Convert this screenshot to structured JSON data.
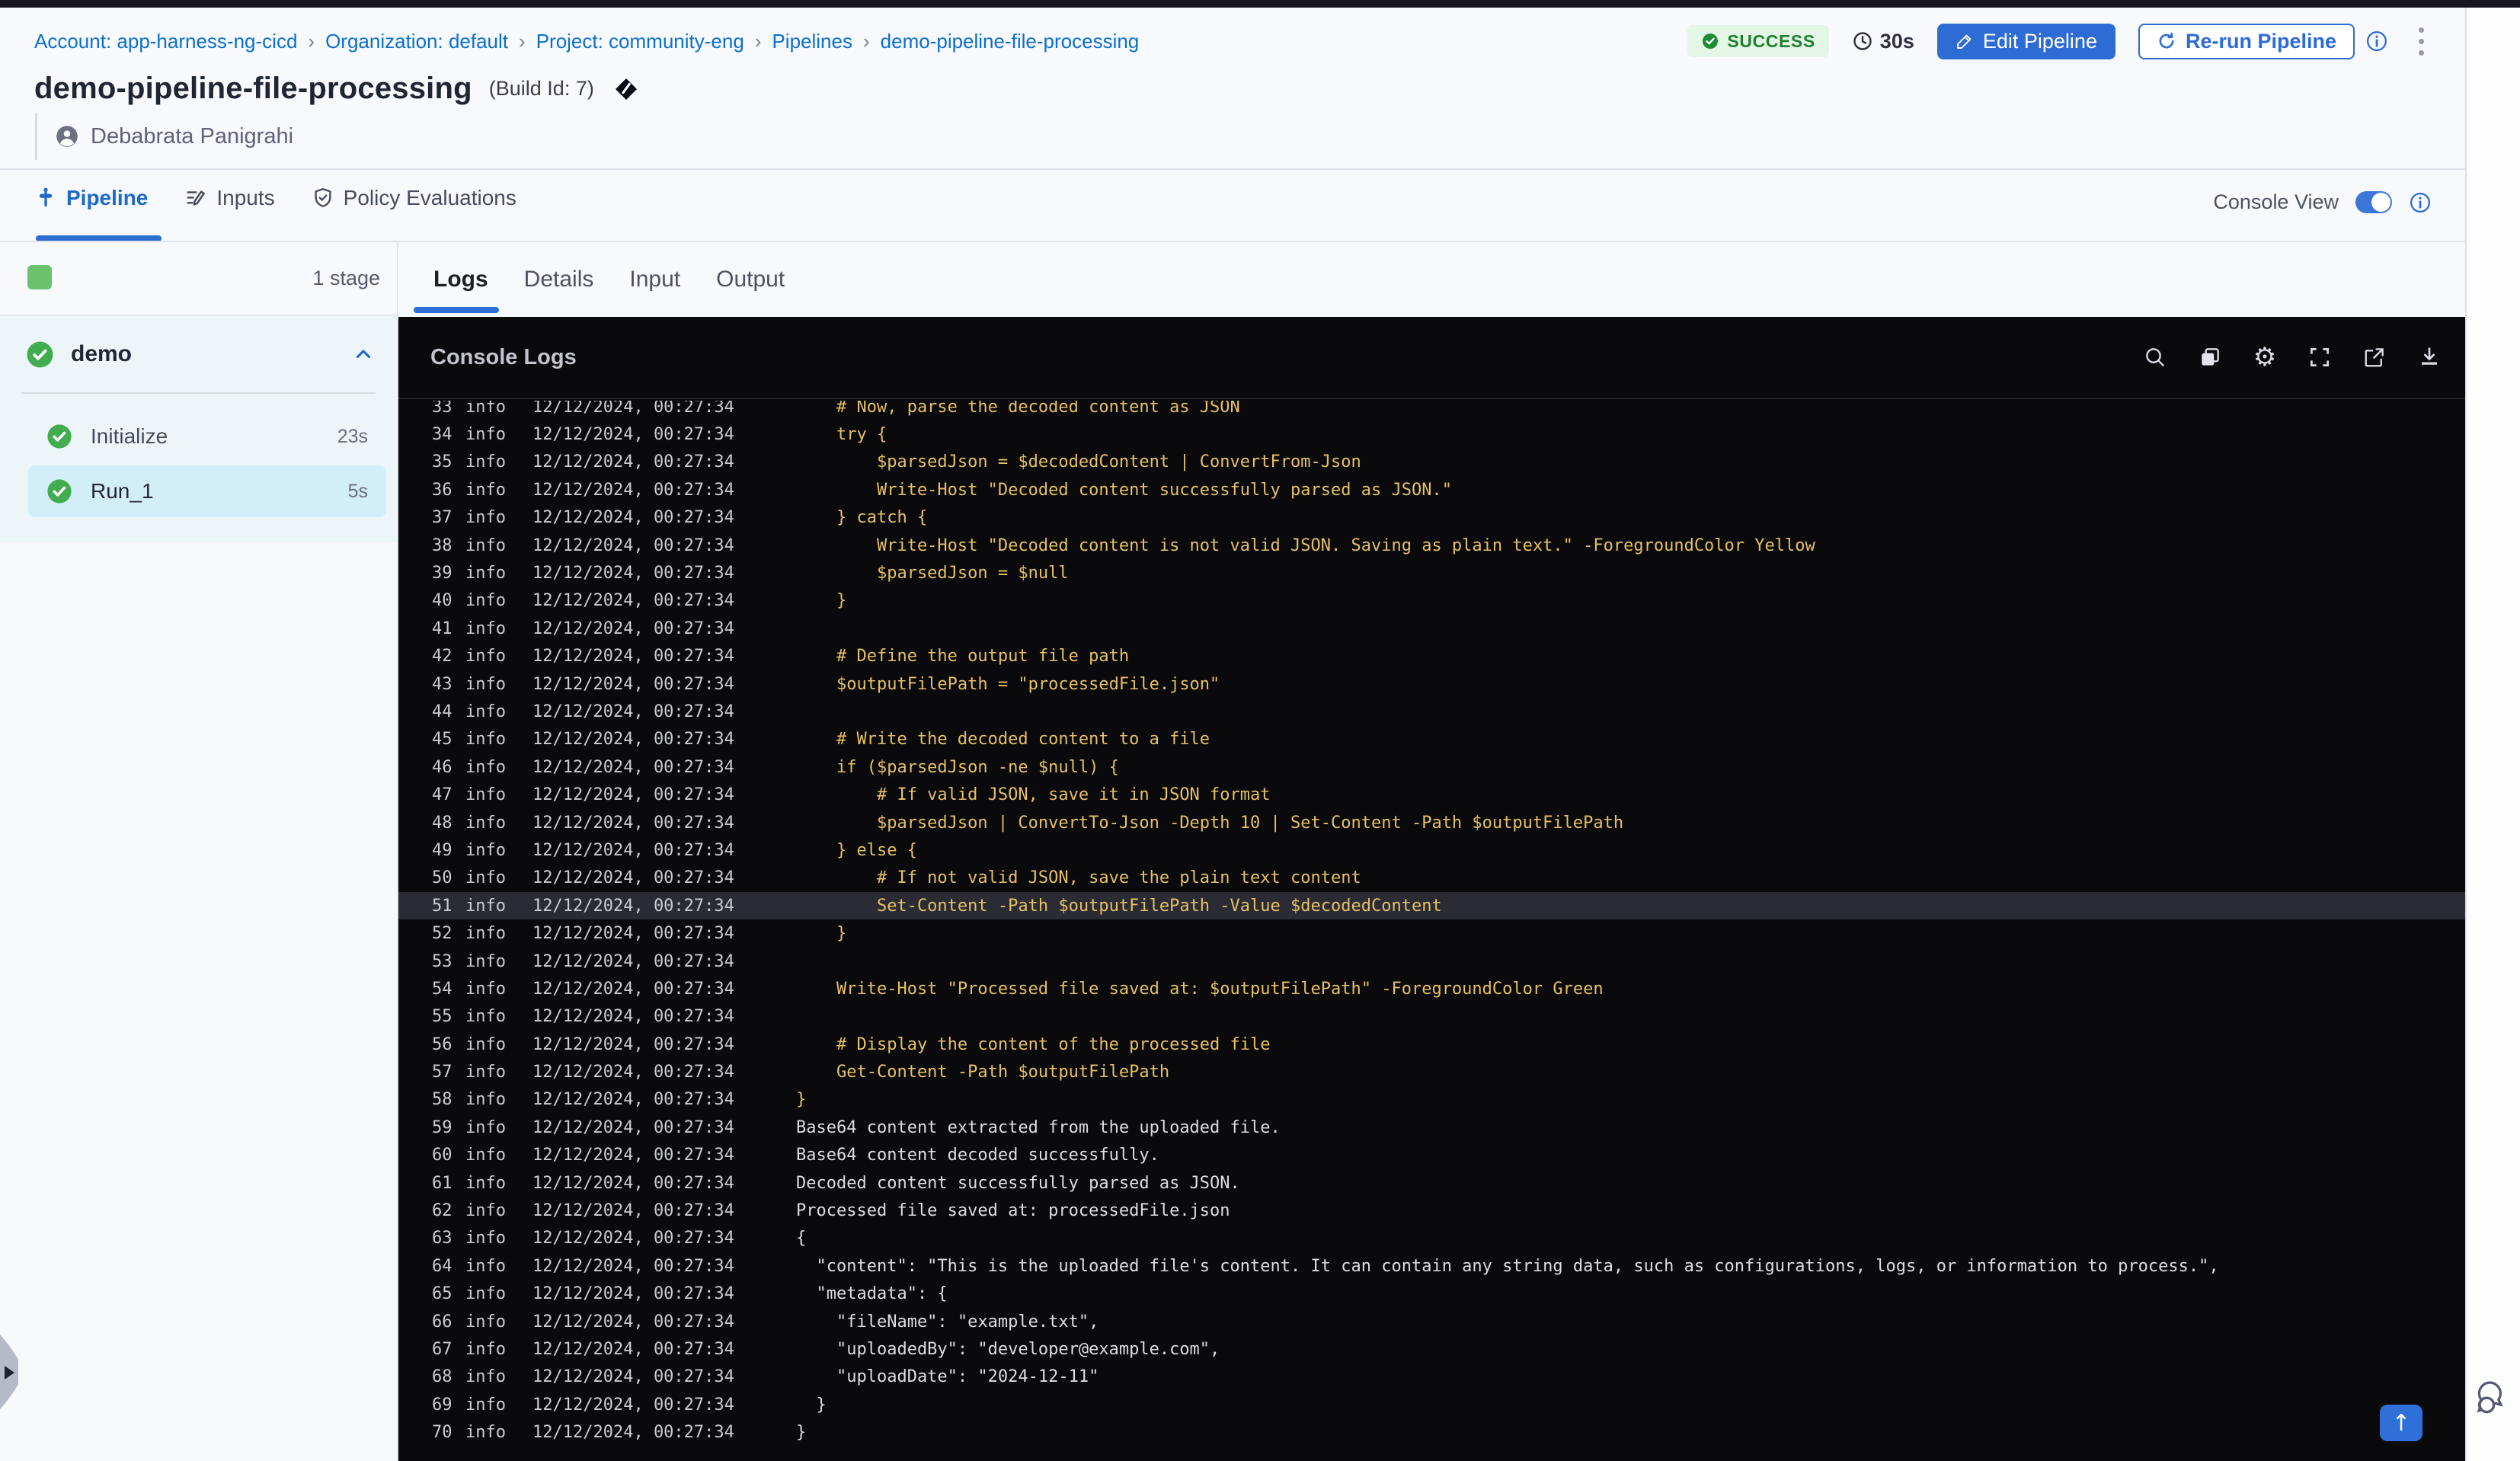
{
  "colors": {
    "accent_blue": "#2d6bd5",
    "link_blue": "#0b6fd0",
    "success_bg": "#e4f6e5",
    "success_text": "#1d8030",
    "stage_green": "#6cc16c",
    "check_green": "#42ad4e",
    "console_bg": "#0a0a0c",
    "console_script_yellow": "#e5c065",
    "console_plain_text": "#dcdde0",
    "selected_step_bg": "#d2eef9",
    "highlight_row_bg": "#2b2b33"
  },
  "topbar": {
    "breadcrumb": [
      "Account: app-harness-ng-cicd",
      "Organization: default",
      "Project: community-eng",
      "Pipelines",
      "demo-pipeline-file-processing"
    ],
    "separator": "›",
    "status": "SUCCESS",
    "duration": "30s",
    "edit_label": "Edit Pipeline",
    "rerun_label": "Re-run Pipeline"
  },
  "header": {
    "title": "demo-pipeline-file-processing",
    "build_id": "(Build Id: 7)",
    "author": "Debabrata Panigrahi"
  },
  "pipeline_tabs": [
    {
      "label": "Pipeline",
      "active": true
    },
    {
      "label": "Inputs",
      "active": false
    },
    {
      "label": "Policy Evaluations",
      "active": false
    }
  ],
  "console_view": {
    "label": "Console View",
    "enabled": true
  },
  "sidebar": {
    "stage_count": "1 stage",
    "stage_name": "demo",
    "steps": [
      {
        "name": "Initialize",
        "duration": "23s",
        "selected": false
      },
      {
        "name": "Run_1",
        "duration": "5s",
        "selected": true
      }
    ]
  },
  "panel": {
    "tabs": [
      {
        "label": "Logs",
        "active": true
      },
      {
        "label": "Details",
        "active": false
      },
      {
        "label": "Input",
        "active": false
      },
      {
        "label": "Output",
        "active": false
      }
    ],
    "console_title": "Console Logs",
    "toolbar_icons": [
      "search-icon",
      "copy-icon",
      "settings-icon",
      "fullscreen-icon",
      "open-in-new-icon",
      "download-icon"
    ],
    "scroll_top_arrow": "↑"
  },
  "console": {
    "level": "info",
    "timestamp": "12/12/2024, 00:27:34",
    "rows": [
      {
        "n": 33,
        "kind": "script",
        "text": "    # Now, parse the decoded content as JSON"
      },
      {
        "n": 34,
        "kind": "script",
        "text": "    try {"
      },
      {
        "n": 35,
        "kind": "script",
        "text": "        $parsedJson = $decodedContent | ConvertFrom-Json"
      },
      {
        "n": 36,
        "kind": "script",
        "text": "        Write-Host \"Decoded content successfully parsed as JSON.\""
      },
      {
        "n": 37,
        "kind": "script",
        "text": "    } catch {"
      },
      {
        "n": 38,
        "kind": "script",
        "text": "        Write-Host \"Decoded content is not valid JSON. Saving as plain text.\" -ForegroundColor Yellow"
      },
      {
        "n": 39,
        "kind": "script",
        "text": "        $parsedJson = $null"
      },
      {
        "n": 40,
        "kind": "script",
        "text": "    }"
      },
      {
        "n": 41,
        "kind": "script",
        "text": ""
      },
      {
        "n": 42,
        "kind": "script",
        "text": "    # Define the output file path"
      },
      {
        "n": 43,
        "kind": "script",
        "text": "    $outputFilePath = \"processedFile.json\""
      },
      {
        "n": 44,
        "kind": "script",
        "text": ""
      },
      {
        "n": 45,
        "kind": "script",
        "text": "    # Write the decoded content to a file"
      },
      {
        "n": 46,
        "kind": "script",
        "text": "    if ($parsedJson -ne $null) {"
      },
      {
        "n": 47,
        "kind": "script",
        "text": "        # If valid JSON, save it in JSON format"
      },
      {
        "n": 48,
        "kind": "script",
        "text": "        $parsedJson | ConvertTo-Json -Depth 10 | Set-Content -Path $outputFilePath"
      },
      {
        "n": 49,
        "kind": "script",
        "text": "    } else {"
      },
      {
        "n": 50,
        "kind": "script",
        "text": "        # If not valid JSON, save the plain text content"
      },
      {
        "n": 51,
        "kind": "script",
        "text": "        Set-Content -Path $outputFilePath -Value $decodedContent",
        "hl": true
      },
      {
        "n": 52,
        "kind": "script",
        "text": "    }"
      },
      {
        "n": 53,
        "kind": "script",
        "text": ""
      },
      {
        "n": 54,
        "kind": "script",
        "text": "    Write-Host \"Processed file saved at: $outputFilePath\" -ForegroundColor Green"
      },
      {
        "n": 55,
        "kind": "script",
        "text": ""
      },
      {
        "n": 56,
        "kind": "script",
        "text": "    # Display the content of the processed file"
      },
      {
        "n": 57,
        "kind": "script",
        "text": "    Get-Content -Path $outputFilePath"
      },
      {
        "n": 58,
        "kind": "script",
        "text": "}"
      },
      {
        "n": 59,
        "kind": "plain",
        "text": "Base64 content extracted from the uploaded file."
      },
      {
        "n": 60,
        "kind": "plain",
        "text": "Base64 content decoded successfully."
      },
      {
        "n": 61,
        "kind": "plain",
        "text": "Decoded content successfully parsed as JSON."
      },
      {
        "n": 62,
        "kind": "plain",
        "text": "Processed file saved at: processedFile.json"
      },
      {
        "n": 63,
        "kind": "plain",
        "text": "{"
      },
      {
        "n": 64,
        "kind": "plain",
        "text": "  \"content\": \"This is the uploaded file's content. It can contain any string data, such as configurations, logs, or information to process.\","
      },
      {
        "n": 65,
        "kind": "plain",
        "text": "  \"metadata\": {"
      },
      {
        "n": 66,
        "kind": "plain",
        "text": "    \"fileName\": \"example.txt\","
      },
      {
        "n": 67,
        "kind": "plain",
        "text": "    \"uploadedBy\": \"developer@example.com\","
      },
      {
        "n": 68,
        "kind": "plain",
        "text": "    \"uploadDate\": \"2024-12-11\""
      },
      {
        "n": 69,
        "kind": "plain",
        "text": "  }"
      },
      {
        "n": 70,
        "kind": "plain",
        "text": "}"
      }
    ]
  }
}
